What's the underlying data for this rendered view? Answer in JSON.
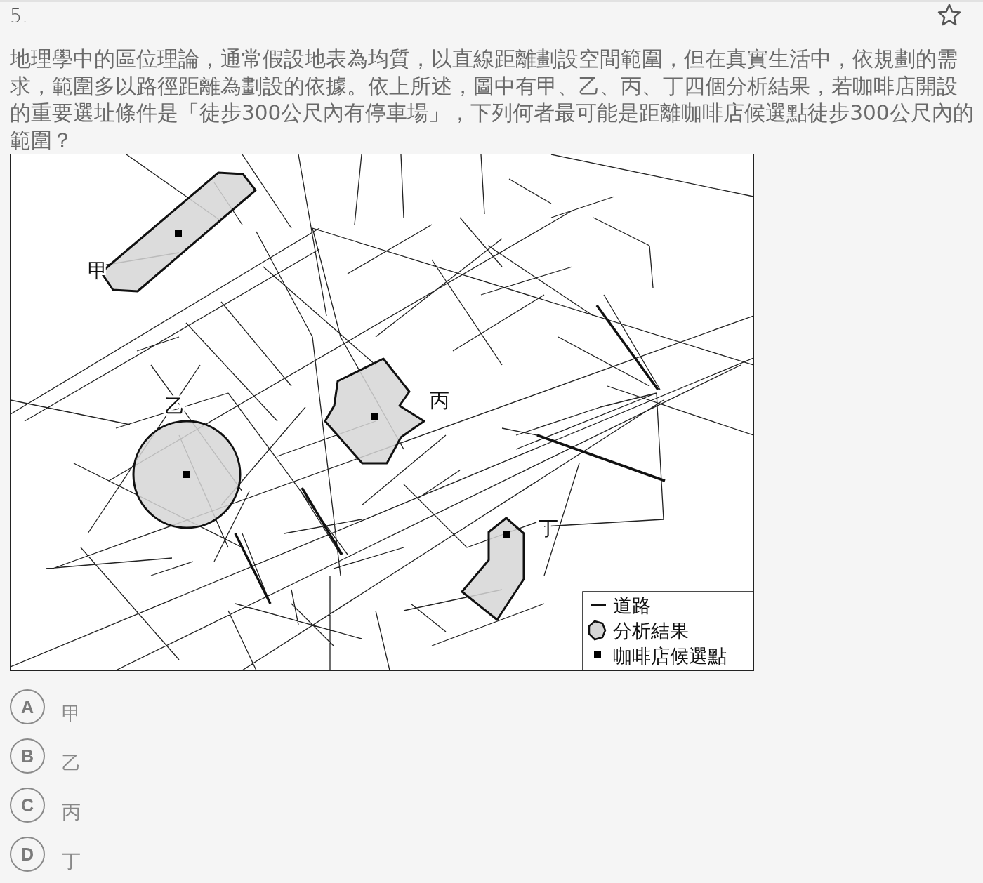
{
  "question": {
    "number": "5.",
    "bookmarked": false,
    "text": "地理學中的區位理論，通常假設地表為均質，以直線距離劃設空間範圍，但在真實生活中，依規劃的需求，範圍多以路徑距離為劃設的依據。依上所述，圖中有甲、乙、丙、丁四個分析結果，若咖啡店開設的重要選址條件是「徒步300公尺內有停車場」，下列何者最可能是距離咖啡店候選點徒步300公尺內的範圍？"
  },
  "map": {
    "areas": [
      {
        "label": "甲",
        "kind": "strip"
      },
      {
        "label": "乙",
        "kind": "circle"
      },
      {
        "label": "丙",
        "kind": "star"
      },
      {
        "label": "丁",
        "kind": "blob"
      }
    ],
    "legend": [
      {
        "kind": "road",
        "text": "道路"
      },
      {
        "kind": "area",
        "text": "分析結果"
      },
      {
        "kind": "point",
        "text": "咖啡店候選點"
      }
    ]
  },
  "options": [
    {
      "letter": "A",
      "text": "甲"
    },
    {
      "letter": "B",
      "text": "乙"
    },
    {
      "letter": "C",
      "text": "丙"
    },
    {
      "letter": "D",
      "text": "丁"
    }
  ]
}
